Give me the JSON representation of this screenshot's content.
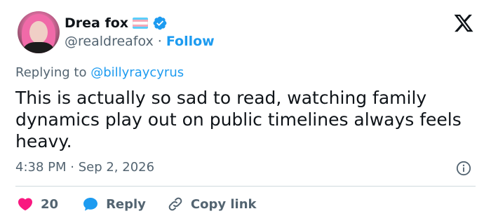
{
  "author": {
    "name": "Drea fox",
    "handle": "@realdreafox",
    "separator": "·",
    "follow_label": "Follow"
  },
  "tweet": {
    "replying_prefix": "Replying to",
    "replying_to": "@billyraycyrus",
    "text": "This is actually so sad to read, watching family dynamics play out on public timelines always feels heavy.",
    "timestamp": "4:38 PM · Sep 2, 2026"
  },
  "actions": {
    "like_count": "20",
    "reply_label": "Reply",
    "copy_link_label": "Copy link"
  },
  "icons": {
    "flag": "transgender-flag-icon",
    "verified": "verified-badge-icon",
    "logo": "x-logo-icon",
    "info": "info-icon",
    "like": "heart-icon",
    "reply": "speech-bubble-icon",
    "copy": "link-icon"
  },
  "colors": {
    "accent": "#1d9bf0",
    "like": "#f91880",
    "text": "#0f1419",
    "muted": "#536471",
    "flag_blue": "#5bcefa",
    "flag_pink": "#f5a9b8",
    "flag_white": "#ffffff"
  }
}
